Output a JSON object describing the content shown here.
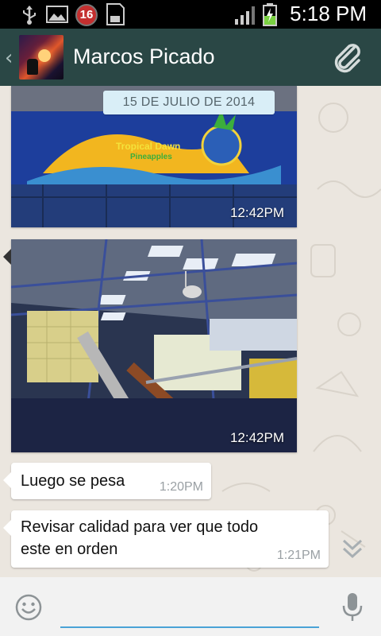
{
  "status_bar": {
    "time": "5:18 PM",
    "notification_count": "16",
    "battery_level": 0.45,
    "icons": [
      "usb-icon",
      "image-notification-icon",
      "badge-icon",
      "sd-card-icon",
      "signal-icon",
      "battery-charging-icon"
    ]
  },
  "header": {
    "back_icon": "chevron-left-icon",
    "contact_name": "Marcos Picado",
    "attach_icon": "paperclip-icon"
  },
  "chat": {
    "date_separator": "15 DE JULIO DE 2014",
    "messages": [
      {
        "type": "image",
        "caption_on_image": "Tropical Dawn",
        "caption_sub": "Pineapples",
        "time": "12:42PM"
      },
      {
        "type": "image",
        "time": "12:42PM"
      },
      {
        "type": "text",
        "text": "Luego se pesa",
        "time": "1:20PM"
      },
      {
        "type": "text",
        "text_line1": "Revisar calidad para ver que todo",
        "text_line2": "este en orden",
        "time": "1:21PM"
      }
    ]
  },
  "input_bar": {
    "emoji_icon": "smiley-icon",
    "text_value": "",
    "mic_icon": "microphone-icon"
  },
  "colors": {
    "header_bg": "#2a4745",
    "chat_bg": "#ebe6df",
    "input_underline": "#4aa3d6"
  }
}
